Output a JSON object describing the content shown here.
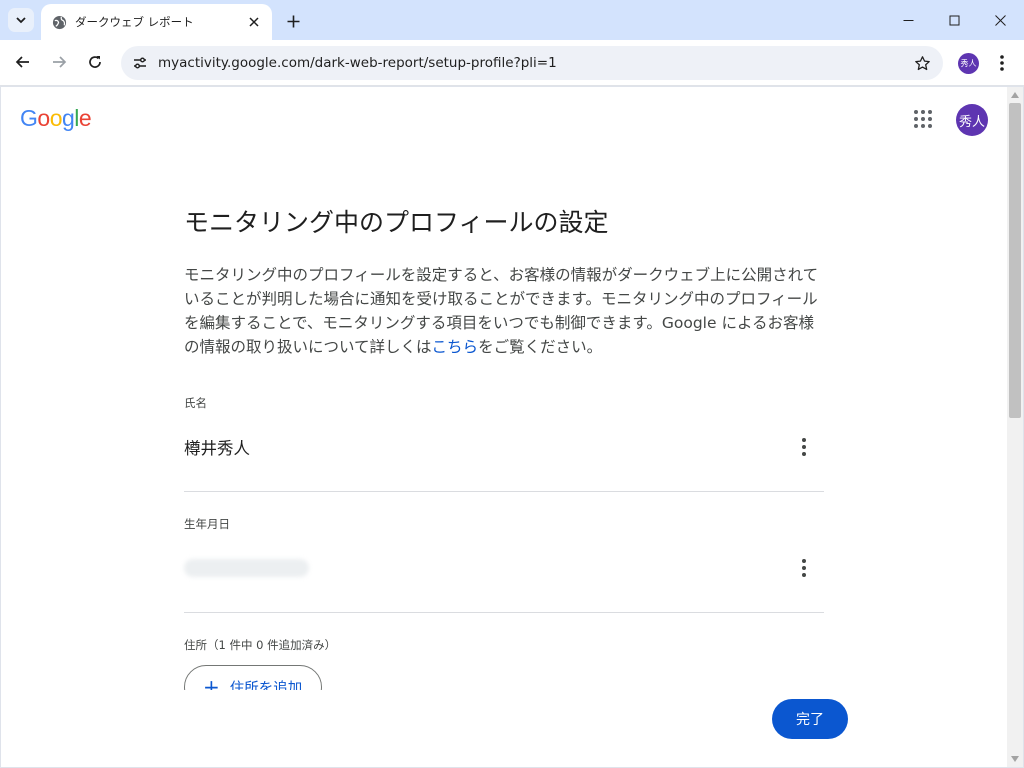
{
  "browser": {
    "tab_title": "ダークウェブ レポート",
    "url": "myactivity.google.com/dark-web-report/setup-profile?pli=1",
    "profile_initials": "秀人"
  },
  "page": {
    "logo_text": "Google",
    "avatar_initials": "秀人",
    "title": "モニタリング中のプロフィールの設定",
    "description_before_link": "モニタリング中のプロフィールを設定すると、お客様の情報がダークウェブ上に公開されていることが判明した場合に通知を受け取ることができます。モニタリング中のプロフィールを編集することで、モニタリングする項目をいつでも制御できます。Google によるお客様の情報の取り扱いについて詳しくは",
    "description_link": "こちら",
    "description_after_link": "をご覧ください。",
    "name_label": "氏名",
    "name_value": "樽井秀人",
    "birthdate_label": "生年月日",
    "address_label": "住所（1 件中 0 件追加済み）",
    "add_address_button": "住所を追加",
    "done_button": "完了"
  },
  "colors": {
    "accent": "#0b57d0",
    "avatar": "#5e35b1"
  }
}
